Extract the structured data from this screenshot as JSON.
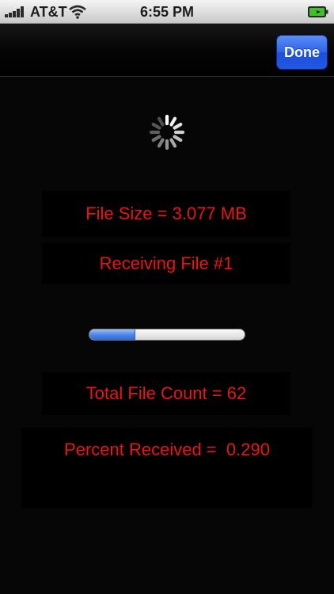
{
  "status_bar": {
    "carrier": "AT&T",
    "time": "6:55 PM",
    "signal_bars": 5,
    "battery_charging": true
  },
  "nav_bar": {
    "done_label": "Done"
  },
  "activity_indicator": {
    "spinning": true
  },
  "transfer": {
    "file_size_text": "File Size = 3.077 MB",
    "receiving_text": "Receiving File #1",
    "progress_fraction": 0.29,
    "total_count_text": "Total File Count = 62",
    "percent_text": "Percent Received =  0.290"
  },
  "colors": {
    "label_text": "#ee1414",
    "background": "#060606",
    "button_blue": "#2b63e9",
    "progress_blue": "#4e87ec"
  },
  "icons": [
    "signal-bars-icon",
    "wifi-icon",
    "battery-charging-icon",
    "activity-spinner-icon"
  ]
}
